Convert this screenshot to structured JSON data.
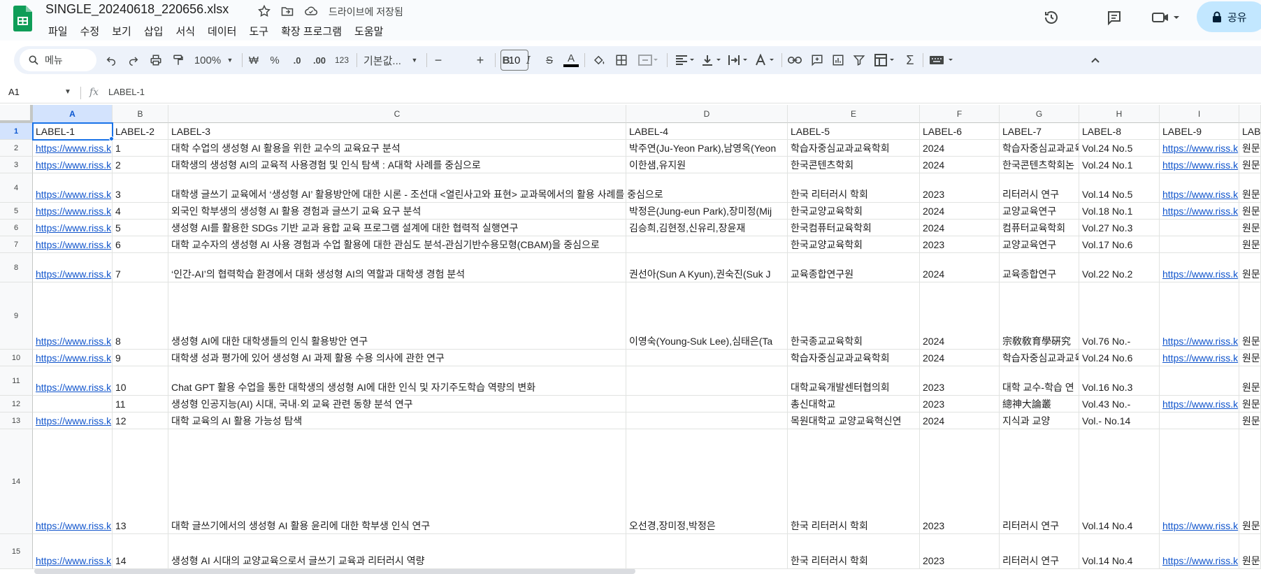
{
  "app": {
    "doc_title": "SINGLE_20240618_220656.xlsx",
    "save_status": "드라이브에 저장됨",
    "share_label": "공유",
    "colors": {
      "brand": "#0f9d58",
      "accent": "#1a73e8",
      "link": "#1155cc",
      "share_bg": "#c2e7ff"
    }
  },
  "menu": [
    "파일",
    "수정",
    "보기",
    "삽입",
    "서식",
    "데이터",
    "도구",
    "확장 프로그램",
    "도움말"
  ],
  "toolbar": {
    "search_placeholder": "메뉴",
    "zoom": "100%",
    "currency": "₩",
    "percent": "%",
    "dec_decrease": ".0",
    "dec_increase": ".00",
    "number_format": "123",
    "font_family": "기본값...",
    "font_size": "10",
    "minus": "−",
    "plus": "+",
    "bold": "B",
    "italic": "I",
    "strike": "S",
    "text_color": "A",
    "sum": "Σ",
    "icons": [
      "search-icon",
      "undo-icon",
      "redo-icon",
      "print-icon",
      "paint-format-icon",
      "fill-color-icon",
      "borders-icon",
      "merge-icon",
      "align-icon",
      "valign-icon",
      "wrap-icon",
      "rotate-icon",
      "link-icon",
      "comment-icon",
      "chart-icon",
      "filter-icon",
      "table-icon",
      "functions-icon",
      "keyboard-icon"
    ]
  },
  "formula": {
    "name_box": "A1",
    "fx": "fx",
    "value": "LABEL-1"
  },
  "columns": [
    "A",
    "B",
    "C",
    "D",
    "E",
    "F",
    "G",
    "H",
    "I"
  ],
  "rows": [
    {
      "num": "1",
      "cells": [
        "LABEL-1",
        "LABEL-2",
        "LABEL-3",
        "LABEL-4",
        "LABEL-5",
        "LABEL-6",
        "LABEL-7",
        "LABEL-8",
        "LABEL-9",
        "LAB"
      ]
    },
    {
      "num": "2",
      "cells": [
        "https://www.riss.k",
        "1",
        "대학 수업의 생성형 AI 활용을 위한 교수의 교육요구 분석",
        "박주연(Ju-Yeon Park),남영옥(Yeon",
        "학습자중심교과교육학회",
        "2024",
        "학습자중심교과교육",
        "Vol.24 No.5",
        "https://www.riss.k",
        "원문"
      ]
    },
    {
      "num": "3",
      "cells": [
        "https://www.riss.k",
        "2",
        "대학생의 생성형 AI의 교육적 사용경험 및 인식 탐색 : A대학 사례를 중심으로",
        "이한샘,유지원",
        "한국콘텐츠학회",
        "2024",
        "한국콘텐츠학회논",
        "Vol.24 No.1",
        "https://www.riss.k",
        "원문"
      ]
    },
    {
      "num": "4",
      "cells": [
        "https://www.riss.k",
        "3",
        "대학생 글쓰기 교육에서 ‘생성형 AI’ 활용방안에 대한 시론 - 조선대 <열린사고와 표현> 교과목에서의 활용 사례를 중심으로",
        "",
        "한국 리터러시 학회",
        "2023",
        "리터러시 연구",
        "Vol.14 No.5",
        "https://www.riss.k",
        "원문"
      ]
    },
    {
      "num": "5",
      "cells": [
        "https://www.riss.k",
        "4",
        "외국인 학부생의 생성형 AI 활용 경험과 글쓰기 교육 요구 분석",
        "박정은(Jung-eun Park),장미정(Mij",
        "한국교양교육학회",
        "2024",
        "교양교육연구",
        "Vol.18 No.1",
        "https://www.riss.k",
        "원문"
      ]
    },
    {
      "num": "6",
      "cells": [
        "https://www.riss.k",
        "5",
        "생성형 AI를 활용한 SDGs 기반 교과 융합 교육 프로그램 설계에 대한 협력적 실행연구",
        "김승희,김현정,신유리,장윤재",
        "한국컴퓨터교육학회",
        "2024",
        "컴퓨터교육학회",
        "Vol.27 No.3",
        "",
        "원문"
      ]
    },
    {
      "num": "7",
      "cells": [
        "https://www.riss.k",
        "6",
        "대학 교수자의 생성형 AI 사용 경험과 수업 활용에 대한 관심도 분석-관심기반수용모형(CBAM)을 중심으로",
        "",
        "한국교양교육학회",
        "2023",
        "교양교육연구",
        "Vol.17 No.6",
        "",
        "원문"
      ]
    },
    {
      "num": "8",
      "cells": [
        "https://www.riss.k",
        "7",
        "‘인간-AI’의 협력학습 환경에서 대화 생성형 AI의 역할과 대학생 경험 분석",
        "권선아(Sun A Kyun),권숙진(Suk J",
        "교육종합연구원",
        "2024",
        "교육종합연구",
        "Vol.22 No.2",
        "https://www.riss.k",
        "원문"
      ]
    },
    {
      "num": "9",
      "cells": [
        "https://www.riss.k",
        "8",
        "생성형 AI에 대한 대학생들의 인식 활용방안 연구",
        "이영숙(Young-Suk Lee),심태은(Ta",
        "한국종교교육학회",
        "2024",
        "宗敎敎育學硏究",
        "Vol.76 No.-",
        "https://www.riss.k",
        "원문"
      ]
    },
    {
      "num": "10",
      "cells": [
        "https://www.riss.k",
        "9",
        "대학생 성과 평가에 있어 생성형 AI 과제 활용 수용 의사에 관한 연구",
        "",
        "학습자중심교과교육학회",
        "2024",
        "학습자중심교과교육",
        "Vol.24 No.6",
        "https://www.riss.k",
        "원문"
      ]
    },
    {
      "num": "11",
      "cells": [
        "https://www.riss.k",
        "10",
        "Chat GPT 활용 수업을 통한 대학생의 생성형 AI에 대한 인식 및 자기주도학습 역량의 변화",
        "",
        "대학교육개발센터협의회",
        "2023",
        "대학 교수-학습 연",
        "Vol.16 No.3",
        "",
        "원문"
      ]
    },
    {
      "num": "12",
      "cells": [
        "",
        "11",
        "생성형 인공지능(AI) 시대, 국내·외  교육 관련 동향 분석 연구",
        "",
        "총신대학교",
        "2023",
        "總神大論叢",
        "Vol.43 No.-",
        "https://www.riss.k",
        "원문"
      ]
    },
    {
      "num": "13",
      "cells": [
        "https://www.riss.k",
        "12",
        "대학 교육의 AI 활용 가능성 탐색",
        "",
        "목원대학교 교양교육혁신연",
        "2024",
        "지식과 교양",
        "Vol.- No.14",
        "",
        "원문"
      ]
    },
    {
      "num": "14",
      "cells": [
        "https://www.riss.k",
        "13",
        "대학 글쓰기에서의 생성형 AI 활용 윤리에 대한  학부생 인식 연구",
        "오선경,장미정,박정은",
        "한국 리터러시 학회",
        "2023",
        "리터러시 연구",
        "Vol.14 No.4",
        "https://www.riss.k",
        "원문"
      ]
    },
    {
      "num": "15",
      "cells": [
        "https://www.riss.k",
        "14",
        "생성형 AI 시대의 교양교육으로서 글쓰기 교육과  리터러시 역량",
        "",
        "한국 리터러시 학회",
        "2023",
        "리터러시 연구",
        "Vol.14 No.4",
        "https://www.riss.k",
        "원문"
      ]
    }
  ]
}
